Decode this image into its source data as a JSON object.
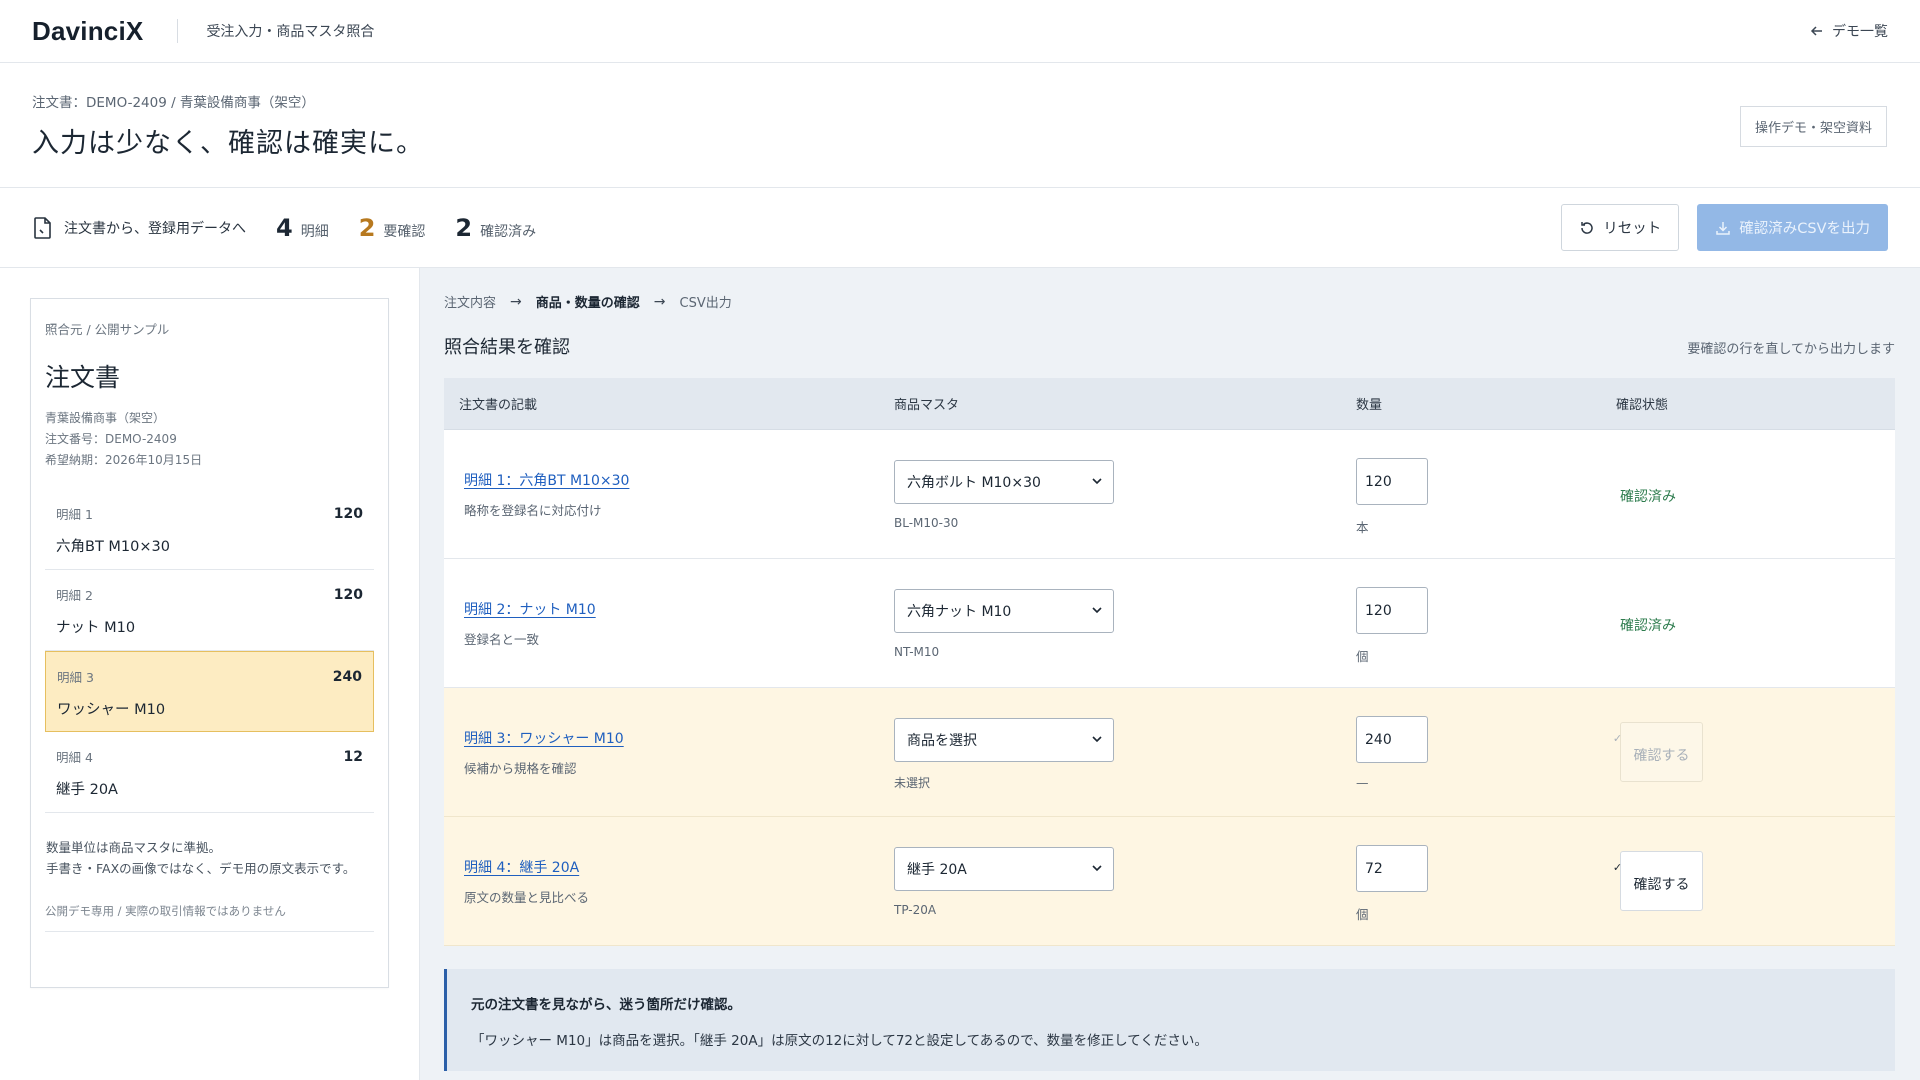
{
  "app": {
    "logo": "DavinciX",
    "subtitle": "受注入力・商品マスタ照合",
    "back_label": "デモ一覧"
  },
  "header": {
    "breadcrumb": "注文書：DEMO-2409 / 青葉設備商事（架空）",
    "title": "入力は少なく、確認は確実に。",
    "badge": "操作デモ・架空資料"
  },
  "toolbar": {
    "flow_label": "注文書から、登録用データへ",
    "stats": [
      {
        "num": "4",
        "label": "明細"
      },
      {
        "num": "2",
        "label": "要確認"
      },
      {
        "num": "2",
        "label": "確認済み"
      }
    ],
    "reset_label": "リセット",
    "export_label": "確認済みCSVを出力"
  },
  "document": {
    "source": "照合元 / 公開サンプル",
    "title": "注文書",
    "customer": "青葉設備商事（架空）",
    "order_no": "注文番号：DEMO-2409",
    "due": "希望納期：2026年10月15日",
    "items": [
      {
        "line": "明細 1",
        "qty": "120",
        "name": "六角BT M10×30"
      },
      {
        "line": "明細 2",
        "qty": "120",
        "name": "ナット M10"
      },
      {
        "line": "明細 3",
        "qty": "240",
        "name": "ワッシャー M10"
      },
      {
        "line": "明細 4",
        "qty": "12",
        "name": "継手 20A"
      }
    ],
    "note1": "数量単位は商品マスタに準拠。",
    "note2": "手書き・FAXの画像ではなく、デモ用の原文表示です。",
    "footer": "公開デモ専用 / 実際の取引情報ではありません"
  },
  "steps": [
    "注文内容",
    "商品・数量の確認",
    "CSV出力"
  ],
  "section": {
    "title": "照合結果を確認",
    "hint": "要確認の行を直してから出力します"
  },
  "table": {
    "headers": [
      "注文書の記載",
      "商品マスタ",
      "数量",
      "確認状態"
    ],
    "rows": [
      {
        "desc": "明細 1：六角BT M10×30",
        "note": "略称を登録名に対応付け",
        "product": "六角ボルト M10×30",
        "code": "BL-M10-30",
        "qty": "120",
        "unit": "本",
        "status": "確認済み"
      },
      {
        "desc": "明細 2：ナット M10",
        "note": "登録名と一致",
        "product": "六角ナット M10",
        "code": "NT-M10",
        "qty": "120",
        "unit": "個",
        "status": "確認済み"
      },
      {
        "desc": "明細 3：ワッシャー M10",
        "note": "候補から規格を確認",
        "product": "商品を選択",
        "code": "未選択",
        "qty": "240",
        "unit": "—",
        "status": "確認する"
      },
      {
        "desc": "明細 4：継手 20A",
        "note": "原文の数量と見比べる",
        "product": "継手 20A",
        "code": "TP-20A",
        "qty": "72",
        "unit": "個",
        "status": "確認する"
      }
    ]
  },
  "notice": {
    "title": "元の注文書を見ながら、迷う箇所だけ確認。",
    "body": "「ワッシャー M10」は商品を選択。「継手 20A」は原文の12に対して72と設定してあるので、数量を修正してください。"
  },
  "colors": {
    "accent": "#1f5fbf",
    "warn": "#b7791f",
    "ok": "#2f7d4f",
    "highlight": "#fdecc2"
  }
}
